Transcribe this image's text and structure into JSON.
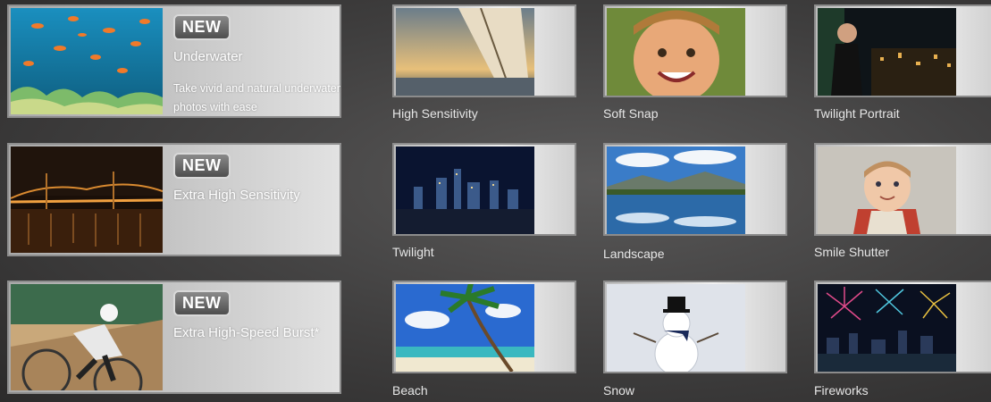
{
  "features": [
    {
      "badge": "NEW",
      "title": "Underwater",
      "desc": "Take vivid and natural underwater photos with ease",
      "image": "underwater-fish-photo"
    },
    {
      "badge": "NEW",
      "title": "Extra High Sensitivity",
      "image": "bridge-night-photo"
    },
    {
      "badge": "NEW",
      "title": "Extra High-Speed Burst*",
      "image": "cyclist-photo"
    }
  ],
  "scenes": [
    {
      "label": "High Sensitivity",
      "image": "sailboat-sunset-photo"
    },
    {
      "label": "Soft Snap",
      "image": "smiling-boy-photo"
    },
    {
      "label": "Twilight Portrait",
      "image": "man-city-night-photo"
    },
    {
      "label": "Twilight",
      "image": "city-skyline-night-photo"
    },
    {
      "label": "Landscape",
      "image": "mountain-lake-photo"
    },
    {
      "label": "Smile Shutter",
      "image": "toddler-photo"
    },
    {
      "label": "Beach",
      "image": "palm-beach-photo"
    },
    {
      "label": "Snow",
      "image": "snowman-photo"
    },
    {
      "label": "Fireworks",
      "image": "fireworks-city-photo"
    }
  ]
}
